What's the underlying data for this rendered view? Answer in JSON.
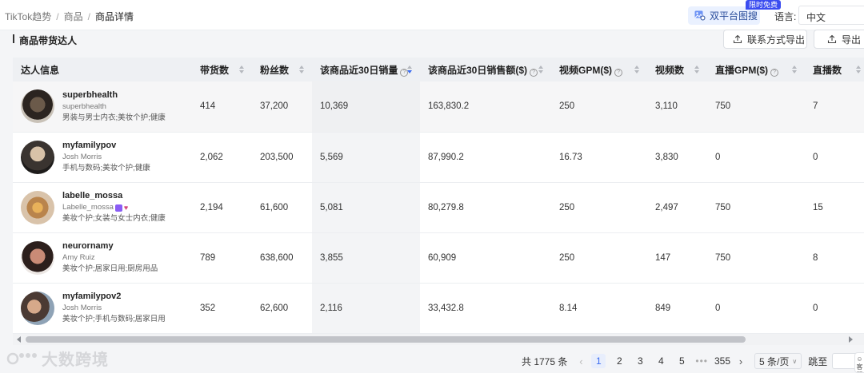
{
  "breadcrumb": [
    "TikTok趋势",
    "商品",
    "商品详情"
  ],
  "header": {
    "image_search_label": "双平台图搜",
    "free_badge": "限时免费",
    "language_label": "语言:",
    "language_value": "中文"
  },
  "section": {
    "title": "商品带货达人",
    "contact_export_label": "联系方式导出",
    "export_label": "导出"
  },
  "table": {
    "columns": [
      "达人信息",
      "带货数",
      "粉丝数",
      "该商品近30日销量",
      "该商品近30日销售额($)",
      "视频GPM($)",
      "视频数",
      "直播GPM($)",
      "直播数"
    ],
    "rows": [
      {
        "handle": "superbhealth",
        "name": "superbhealth",
        "categories": "男装与男士内衣;美妆个护;健康",
        "sales_count": "414",
        "followers": "37,200",
        "units_30d": "10,369",
        "revenue_30d": "163,830.2",
        "video_gpm": "250",
        "videos": "3,110",
        "live_gpm": "750",
        "lives": "7"
      },
      {
        "handle": "myfamilypov",
        "name": "Josh Morris",
        "categories": "手机与数码;美妆个护;健康",
        "sales_count": "2,062",
        "followers": "203,500",
        "units_30d": "5,569",
        "revenue_30d": "87,990.2",
        "video_gpm": "16.73",
        "videos": "3,830",
        "live_gpm": "0",
        "lives": "0"
      },
      {
        "handle": "labelle_mossa",
        "name": "Labelle_mossa",
        "categories": "美妆个护;女装与女士内衣;健康",
        "sales_count": "2,194",
        "followers": "61,600",
        "units_30d": "5,081",
        "revenue_30d": "80,279.8",
        "video_gpm": "250",
        "videos": "2,497",
        "live_gpm": "750",
        "lives": "15"
      },
      {
        "handle": "neurornamy",
        "name": "Amy Ruiz",
        "categories": "美妆个护;居家日用;厨房用品",
        "sales_count": "789",
        "followers": "638,600",
        "units_30d": "3,855",
        "revenue_30d": "60,909",
        "video_gpm": "250",
        "videos": "147",
        "live_gpm": "750",
        "lives": "8"
      },
      {
        "handle": "myfamilypov2",
        "name": "Josh Morris",
        "categories": "美妆个护;手机与数码;居家日用",
        "sales_count": "352",
        "followers": "62,600",
        "units_30d": "2,116",
        "revenue_30d": "33,432.8",
        "video_gpm": "8.14",
        "videos": "849",
        "live_gpm": "0",
        "lives": "0"
      }
    ]
  },
  "pagination": {
    "total": "共 1775 条",
    "pages": [
      "1",
      "2",
      "3",
      "4",
      "5"
    ],
    "active_page": "1",
    "dots": "•••",
    "last_page": "355",
    "page_size": "5 条/页",
    "jump_label": "跳至"
  },
  "watermark": "大数跨境",
  "side_service_label": "客服",
  "colors": {
    "accent": "#3b6cf0",
    "badge": "#3b4df0",
    "header_bg": "#eef0f3"
  }
}
